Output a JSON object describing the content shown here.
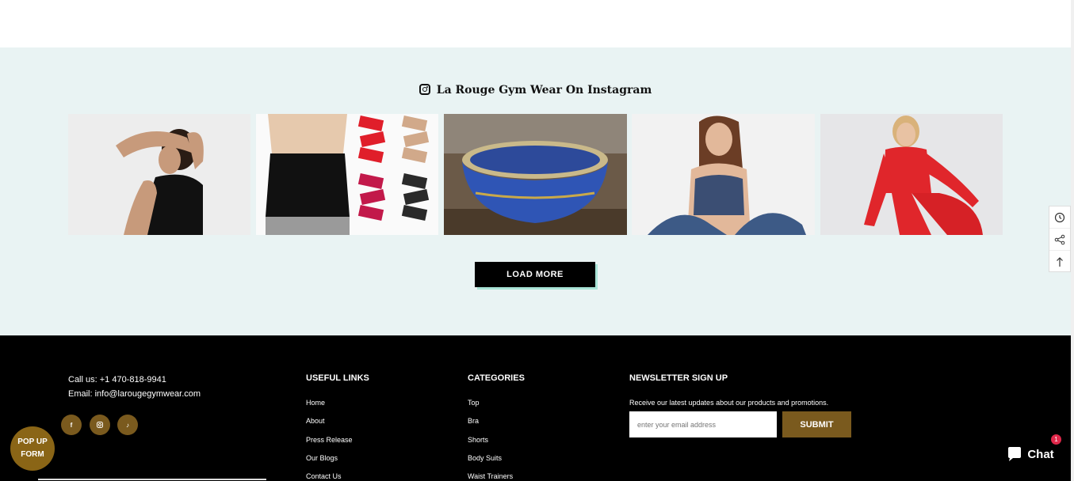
{
  "instagram": {
    "title": "La Rouge Gym Wear On Instagram",
    "load_more": "LOAD MORE"
  },
  "footer": {
    "phone": "Call us: +1 470-818-9941",
    "email": "Email: info@larougegymwear.com",
    "useful_links": {
      "heading": "USEFUL LINKS",
      "items": [
        "Home",
        "About",
        "Press Release",
        "Our Blogs",
        "Contact Us"
      ]
    },
    "categories": {
      "heading": "CATEGORIES",
      "items": [
        "Top",
        "Bra",
        "Shorts",
        "Body Suits",
        "Waist Trainers"
      ]
    },
    "newsletter": {
      "heading": "NEWSLETTER SIGN UP",
      "text": "Receive our latest updates about our products and promotions.",
      "placeholder": "enter your email address",
      "submit": "SUBMIT"
    },
    "social_icons": [
      "facebook-icon",
      "instagram-icon",
      "tiktok-icon"
    ]
  },
  "popup": {
    "line1": "POP UP",
    "line2": "FORM"
  },
  "chat": {
    "label": "Chat",
    "badge": "1"
  },
  "colors": {
    "accent_gold": "#7a5a1e",
    "insta_bg": "#e9f3f3",
    "footer_bg": "#000000"
  }
}
